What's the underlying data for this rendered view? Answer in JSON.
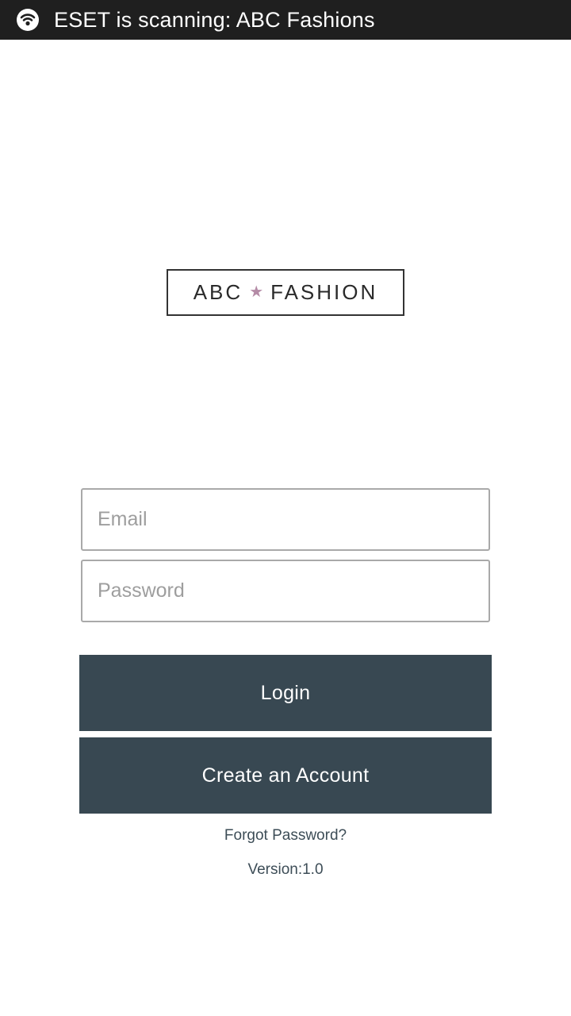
{
  "notification": {
    "icon": "eset-icon",
    "text": "ESET is scanning: ABC Fashions"
  },
  "logo": {
    "left": "ABC",
    "star": "★",
    "right": "FASHION",
    "star_color": "#b48ba6"
  },
  "form": {
    "email_placeholder": "Email",
    "email_value": "",
    "password_placeholder": "Password",
    "password_value": ""
  },
  "buttons": {
    "login_label": "Login",
    "create_account_label": "Create an Account",
    "color": "#384852"
  },
  "links": {
    "forgot_password": "Forgot Password?"
  },
  "version_text": "Version:1.0"
}
